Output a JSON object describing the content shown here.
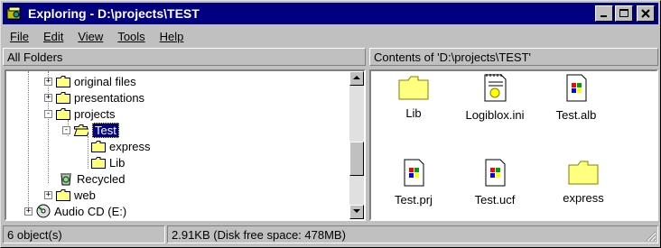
{
  "window": {
    "title": "Exploring - D:\\projects\\TEST"
  },
  "menu": [
    "File",
    "Edit",
    "View",
    "Tools",
    "Help"
  ],
  "left_header": "All Folders",
  "right_header": "Contents of 'D:\\projects\\TEST'",
  "tree": [
    {
      "label": "original files",
      "expander": "+",
      "icon": "folder-icon"
    },
    {
      "label": "presentations",
      "expander": "+",
      "icon": "folder-icon"
    },
    {
      "label": "projects",
      "expander": "-",
      "icon": "folder-icon"
    },
    {
      "label": "Test",
      "expander": "-",
      "icon": "open-folder-icon",
      "selected": true
    },
    {
      "label": "express",
      "expander": "",
      "icon": "folder-icon"
    },
    {
      "label": "Lib",
      "expander": "",
      "icon": "folder-icon"
    },
    {
      "label": "Recycled",
      "expander": "",
      "icon": "recycle-bin-icon"
    },
    {
      "label": "web",
      "expander": "+",
      "icon": "folder-icon"
    },
    {
      "label": "Audio CD (E:)",
      "expander": "+",
      "icon": "cd-icon"
    }
  ],
  "files": [
    {
      "name": "Lib",
      "icon": "folder-icon"
    },
    {
      "name": "Logiblox.ini",
      "icon": "ini-file-icon"
    },
    {
      "name": "Test.alb",
      "icon": "windows-file-icon"
    },
    {
      "name": "Test.prj",
      "icon": "windows-file-icon"
    },
    {
      "name": "Test.ucf",
      "icon": "windows-file-icon"
    },
    {
      "name": "express",
      "icon": "folder-icon"
    }
  ],
  "status": {
    "objects": "6 object(s)",
    "size": "2.91KB (Disk free space: 478MB)"
  },
  "colors": {
    "titlebar": "#000080",
    "folder": "#ffff80",
    "selection": "#000080"
  }
}
